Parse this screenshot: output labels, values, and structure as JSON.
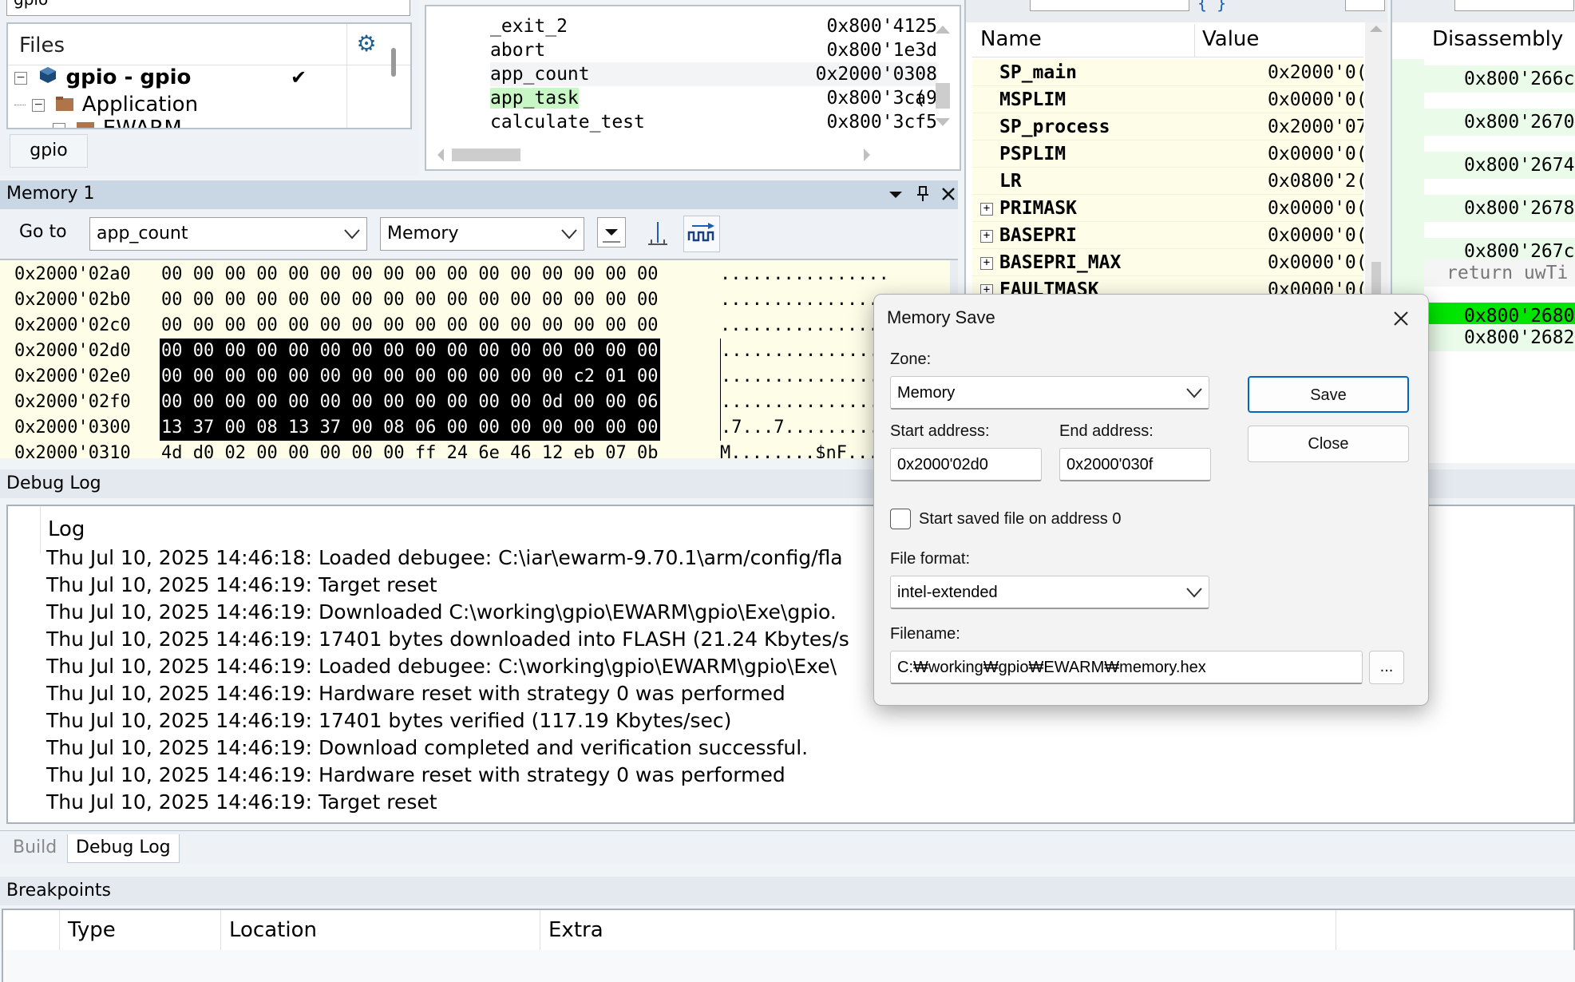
{
  "files": {
    "combo_value": "gpio",
    "title": "Files",
    "tree": [
      {
        "label": "gpio - gpio",
        "bold": true
      },
      {
        "label": "Application",
        "bold": false
      },
      {
        "label": "EWARM",
        "bold": false
      }
    ],
    "tab_label": "gpio"
  },
  "symbols": {
    "rows": [
      {
        "name": "_exit_2",
        "addr": "0x800'4125"
      },
      {
        "name": "abort",
        "addr": "0x800'1e3d"
      },
      {
        "name": "app_count",
        "addr": "0x2000'0308"
      },
      {
        "name": "app_task",
        "addr": "0x800'3ca9"
      },
      {
        "name": "calculate_test",
        "addr": "0x800'3cf5"
      }
    ],
    "extra_char": "("
  },
  "registers": {
    "col_name": "Name",
    "col_value": "Value",
    "rows": [
      {
        "name": "SP_main",
        "value": "0x2000'0(",
        "expandable": false
      },
      {
        "name": "MSPLIM",
        "value": "0x0000'0(",
        "expandable": false
      },
      {
        "name": "SP_process",
        "value": "0x2000'07",
        "expandable": false
      },
      {
        "name": "PSPLIM",
        "value": "0x0000'0(",
        "expandable": false
      },
      {
        "name": "LR",
        "value": "0x0800'2(",
        "expandable": false
      },
      {
        "name": "PRIMASK",
        "value": "0x0000'0(",
        "expandable": true
      },
      {
        "name": "BASEPRI",
        "value": "0x0000'0(",
        "expandable": true
      },
      {
        "name": "BASEPRI_MAX",
        "value": "0x0000'0(",
        "expandable": true
      },
      {
        "name": "FAULTMASK",
        "value": "0x0000'0(",
        "expandable": true
      }
    ]
  },
  "disassembly": {
    "title": "Disassembly",
    "rows": [
      {
        "text": "0x800'266c",
        "highlight": false,
        "source": false
      },
      {
        "text": "0x800'2670",
        "highlight": false,
        "source": false
      },
      {
        "text": "0x800'2674",
        "highlight": false,
        "source": false
      },
      {
        "text": "0x800'2678",
        "highlight": false,
        "source": false
      },
      {
        "text": "0x800'267c",
        "highlight": false,
        "source": false
      },
      {
        "text": "return uwTi",
        "highlight": false,
        "source": true
      },
      {
        "text": "0x800'2680",
        "highlight": true,
        "source": false
      },
      {
        "text": "0x800'2682",
        "highlight": false,
        "source": false
      }
    ]
  },
  "memory": {
    "title": "Memory 1",
    "goto_label": "Go to",
    "goto_value": "app_count",
    "zone_value": "Memory",
    "rows": [
      {
        "addr": "0x2000'02a0",
        "bytes": "00 00 00 00 00 00 00 00 00 00 00 00 00 00 00 00",
        "ascii": "................",
        "selected": false
      },
      {
        "addr": "0x2000'02b0",
        "bytes": "00 00 00 00 00 00 00 00 00 00 00 00 00 00 00 00",
        "ascii": "................",
        "selected": false
      },
      {
        "addr": "0x2000'02c0",
        "bytes": "00 00 00 00 00 00 00 00 00 00 00 00 00 00 00 00",
        "ascii": "................",
        "selected": false
      },
      {
        "addr": "0x2000'02d0",
        "bytes": "00 00 00 00 00 00 00 00 00 00 00 00 00 00 00 00",
        "ascii": "................",
        "selected": true
      },
      {
        "addr": "0x2000'02e0",
        "bytes": "00 00 00 00 00 00 00 00 00 00 00 00 00 c2 01 00",
        "ascii": "................",
        "selected": true
      },
      {
        "addr": "0x2000'02f0",
        "bytes": "00 00 00 00 00 00 00 00 00 00 00 00 0d 00 00 06",
        "ascii": "................",
        "selected": true
      },
      {
        "addr": "0x2000'0300",
        "bytes": "13 37 00 08 13 37 00 08 06 00 00 00 00 00 00 00",
        "ascii": ".7...7..........",
        "selected": true
      },
      {
        "addr": "0x2000'0310",
        "bytes": "4d d0 02 00 00 00 00 00 ff 24 6e 46 12 eb 07 0b",
        "ascii": "M........$nF....",
        "selected": false
      }
    ]
  },
  "debug_log": {
    "bar_title": "Debug Log",
    "header": "Log",
    "lines": [
      "Thu Jul 10, 2025 14:46:18: Loaded debugee: C:\\iar\\ewarm-9.70.1\\arm/config/fla",
      "Thu Jul 10, 2025 14:46:19: Target reset",
      "Thu Jul 10, 2025 14:46:19: Downloaded C:\\working\\gpio\\EWARM\\gpio\\Exe\\gpio.",
      "Thu Jul 10, 2025 14:46:19: 17401 bytes downloaded into FLASH (21.24 Kbytes/s",
      "Thu Jul 10, 2025 14:46:19: Loaded debugee: C:\\working\\gpio\\EWARM\\gpio\\Exe\\",
      "Thu Jul 10, 2025 14:46:19: Hardware reset with strategy 0 was performed",
      "Thu Jul 10, 2025 14:46:19: 17401 bytes verified (117.19 Kbytes/sec)",
      "Thu Jul 10, 2025 14:46:19: Download completed and verification successful.",
      "Thu Jul 10, 2025 14:46:19: Hardware reset with strategy 0 was performed",
      "Thu Jul 10, 2025 14:46:19: Target reset"
    ],
    "tabs": [
      "Build",
      "Debug Log"
    ]
  },
  "breakpoints": {
    "bar_title": "Breakpoints",
    "columns": [
      "Type",
      "Location",
      "Extra"
    ]
  },
  "dialog": {
    "title": "Memory Save",
    "zone_label": "Zone:",
    "zone_value": "Memory",
    "start_label": "Start address:",
    "start_value": "0x2000'02d0",
    "end_label": "End address:",
    "end_value": "0x2000'030f",
    "checkbox_label": "Start saved file on address 0",
    "checkbox_checked": false,
    "format_label": "File format:",
    "format_value": "intel-extended",
    "filename_label": "Filename:",
    "filename_value": "C:₩working₩gpio₩EWARM₩memory.hex",
    "browse_label": "...",
    "save_label": "Save",
    "close_label": "Close"
  },
  "colors": {
    "symbol_highlight": "#c8f7c5",
    "disasm_current": "#00e600",
    "memory_bg": "#fdfde8",
    "selection": "#000000"
  }
}
